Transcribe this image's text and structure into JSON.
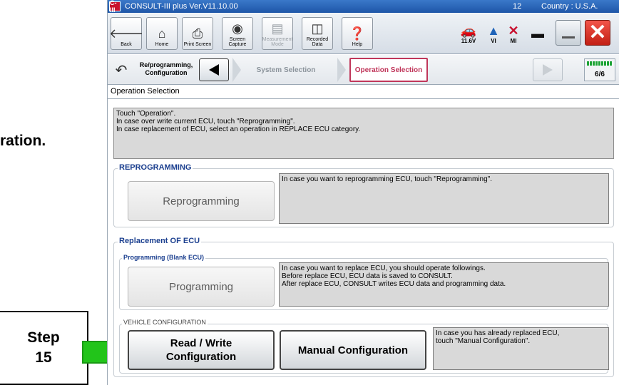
{
  "doc": {
    "left_fragment": "ration.",
    "step_label": "Step",
    "step_number": "15"
  },
  "app": {
    "title": "CONSULT-III plus  Ver.V11.10.00",
    "title_code": "12",
    "country": "Country : U.S.A.",
    "logo_text": "C-III",
    "toolbar": {
      "back": "Back",
      "home": "Home",
      "print_screen": "Print Screen",
      "screen_capture": "Screen Capture",
      "measurement_mode": "Measurement Mode",
      "recorded_data": "Recorded Data",
      "help": "Help",
      "voltage": "11.6V",
      "vi": "VI",
      "mi": "MI"
    },
    "nav": {
      "reprog_config": "Re/programming, Configuration",
      "system_selection": "System Selection",
      "operation_selection": "Operation Selection",
      "step_counter": "6/6",
      "progress_fraction": 1.0
    },
    "section_title": "Operation Selection",
    "instructions": [
      "Touch \"Operation\".",
      "In case over write current ECU, touch \"Reprogramming\".",
      "In case replacement of ECU, select an operation in REPLACE ECU category."
    ],
    "reprogramming": {
      "group_title": "REPROGRAMMING",
      "button": "Reprogramming",
      "description": "In case you want to reprogramming ECU, touch \"Reprogramming\"."
    },
    "replacement": {
      "group_title": "Replacement OF ECU",
      "programming_sub": "Programming (Blank ECU)",
      "programming_button": "Programming",
      "programming_desc": [
        "In case you want to replace ECU, you should operate followings.",
        "Before replace ECU, ECU data is saved to CONSULT.",
        "After replace ECU, CONSULT writes ECU data and programming data."
      ],
      "vehicle_config_sub": "VEHICLE CONFIGURATION",
      "read_write_line1": "Read / Write",
      "read_write_line2": "Configuration",
      "manual_config": "Manual Configuration",
      "config_desc": [
        "In case you has already replaced ECU,",
        "touch \"Manual Configuration\"."
      ]
    }
  },
  "colors": {
    "title_bar": "#1e56a8",
    "accent_red": "#c8102e",
    "crumb_active": "#c0365a",
    "group_title": "#1b3f8f",
    "arrow_fill": "#22c41a",
    "panel_gray": "#d9d9d9"
  }
}
